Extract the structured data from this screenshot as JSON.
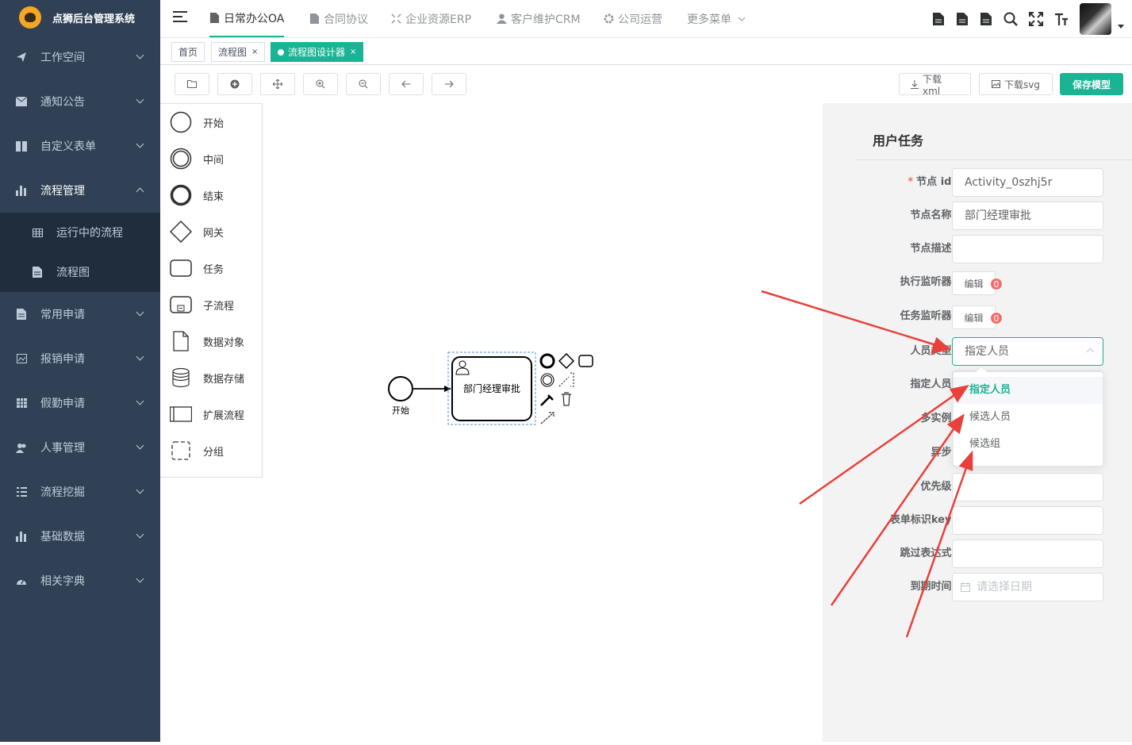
{
  "app": {
    "title": "点狮后台管理系统"
  },
  "sidebar": {
    "items": [
      {
        "label": "工作空间",
        "icon": "send-icon"
      },
      {
        "label": "通知公告",
        "icon": "message-icon"
      },
      {
        "label": "自定义表单",
        "icon": "book-icon"
      },
      {
        "label": "流程管理",
        "icon": "bar-chart-icon",
        "expanded": true
      },
      {
        "label": "常用申请",
        "icon": "document-icon"
      },
      {
        "label": "报销申请",
        "icon": "image-icon"
      },
      {
        "label": "假勤申请",
        "icon": "table-icon"
      },
      {
        "label": "人事管理",
        "icon": "users-icon"
      },
      {
        "label": "流程挖掘",
        "icon": "list-icon"
      },
      {
        "label": "基础数据",
        "icon": "bar-chart-icon"
      },
      {
        "label": "相关字典",
        "icon": "dashboard-icon"
      }
    ],
    "submenu": [
      {
        "label": "运行中的流程",
        "icon": "grid-icon"
      },
      {
        "label": "流程图",
        "icon": "document-icon"
      }
    ]
  },
  "topnav": {
    "tabs": [
      {
        "label": "日常办公OA",
        "icon": "document-icon",
        "active": true
      },
      {
        "label": "合同协议",
        "icon": "document-icon"
      },
      {
        "label": "企业资源ERP",
        "icon": "compress-icon"
      },
      {
        "label": "客户维护CRM",
        "icon": "user-icon"
      },
      {
        "label": "公司运营",
        "icon": "gear-icon"
      },
      {
        "label": "更多菜单",
        "icon": "chevron-down-icon"
      }
    ]
  },
  "tags": {
    "items": [
      {
        "label": "首页",
        "closable": false,
        "active": false
      },
      {
        "label": "流程图",
        "closable": true,
        "active": false
      },
      {
        "label": "流程图设计器",
        "closable": true,
        "active": true
      }
    ],
    "close_glyph": "×"
  },
  "toolbar": {
    "download_xml": "下载xml",
    "download_svg": "下载svg",
    "save_model": "保存模型"
  },
  "palette": {
    "items": [
      {
        "label": "开始",
        "icon": "start-event-icon"
      },
      {
        "label": "中间",
        "icon": "intermediate-event-icon"
      },
      {
        "label": "结束",
        "icon": "end-event-icon"
      },
      {
        "label": "网关",
        "icon": "gateway-icon"
      },
      {
        "label": "任务",
        "icon": "task-icon"
      },
      {
        "label": "子流程",
        "icon": "subprocess-icon"
      },
      {
        "label": "数据对象",
        "icon": "data-object-icon"
      },
      {
        "label": "数据存储",
        "icon": "data-store-icon"
      },
      {
        "label": "扩展流程",
        "icon": "pool-icon"
      },
      {
        "label": "分组",
        "icon": "group-icon"
      }
    ]
  },
  "diagram": {
    "start_label": "开始",
    "task_label": "部门经理审批"
  },
  "props": {
    "title": "用户任务",
    "fields": {
      "node_id": {
        "label": "节点 id ：",
        "value": "Activity_0szhj5r",
        "required": true
      },
      "node_name": {
        "label": "节点名称 ：",
        "value": "部门经理审批"
      },
      "node_desc": {
        "label": "节点描述 ：",
        "value": ""
      },
      "exec_listener": {
        "label": "执行监听器 ：",
        "button": "编辑",
        "count": "0"
      },
      "task_listener": {
        "label": "任务监听器 ：",
        "button": "编辑",
        "count": "0"
      },
      "person_type": {
        "label": "人员类型 ：",
        "value": "指定人员"
      },
      "assignee": {
        "label": "指定人员 ："
      },
      "multi_instance": {
        "label": "多实例 ："
      },
      "async": {
        "label": "异步 ："
      },
      "priority": {
        "label": "优先级 ："
      },
      "form_key": {
        "label": "表单标识key ："
      },
      "skip_expr": {
        "label": "跳过表达式 ："
      },
      "due_date": {
        "label": "到期时间 ：",
        "placeholder": "请选择日期"
      }
    },
    "dropdown_options": [
      "指定人员",
      "候选人员",
      "候选组"
    ],
    "selected_option": "指定人员"
  },
  "colors": {
    "accent": "#1ab394",
    "sidebar": "#304156",
    "annotation": "#e8403a"
  }
}
